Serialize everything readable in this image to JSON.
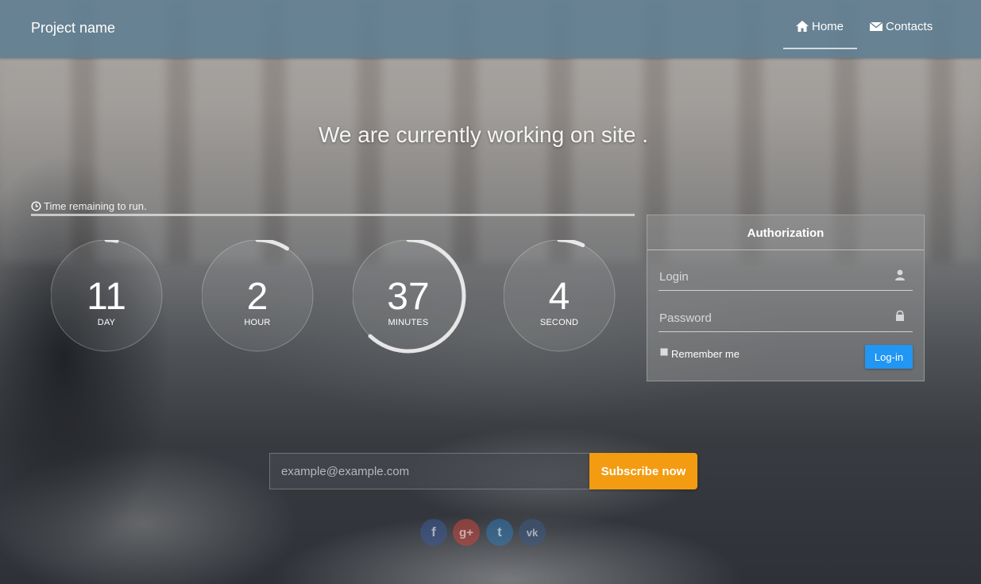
{
  "navbar": {
    "brand": "Project name",
    "items": [
      {
        "label": "Home",
        "icon": "home-icon",
        "active": true
      },
      {
        "label": "Contacts",
        "icon": "envelope-icon",
        "active": false
      }
    ]
  },
  "headline": "We are currently working on site .",
  "timer": {
    "label": "Time remaining to run.",
    "icon": "clock-icon",
    "units": [
      {
        "value": "11",
        "unit": "DAY",
        "progress": 0.03
      },
      {
        "value": "2",
        "unit": "HOUR",
        "progress": 0.09
      },
      {
        "value": "37",
        "unit": "MINUTES",
        "progress": 0.62
      },
      {
        "value": "4",
        "unit": "SECOND",
        "progress": 0.07
      }
    ]
  },
  "auth": {
    "title": "Authorization",
    "login_placeholder": "Login",
    "password_placeholder": "Password",
    "remember_label": "Remember me",
    "login_button": "Log-in"
  },
  "subscribe": {
    "placeholder": "example@example.com",
    "button": "Subscribe now"
  },
  "social": [
    {
      "name": "facebook",
      "glyph": "f"
    },
    {
      "name": "google-plus",
      "glyph": "g+"
    },
    {
      "name": "twitter",
      "glyph": "t"
    },
    {
      "name": "vk",
      "glyph": "vk"
    }
  ],
  "colors": {
    "navbar": "#5f7d91",
    "login_button": "#2196f3",
    "subscribe_button": "#f39c12"
  }
}
